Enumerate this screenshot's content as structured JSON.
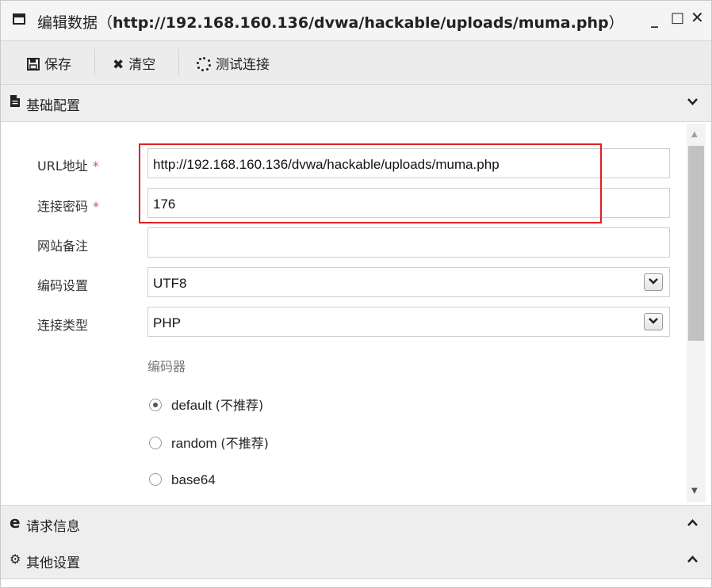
{
  "window": {
    "title_prefix": "编辑数据（",
    "title_url": "http://192.168.160.136/dvwa/hackable/uploads/muma.php",
    "title_suffix": "）",
    "minimize_glyph": "_",
    "maximize_glyph": "□",
    "close_glyph": "✕"
  },
  "toolbar": {
    "save_label": "保存",
    "clear_label": "清空",
    "test_label": "测试连接",
    "save_icon": "floppy-disk-icon",
    "clear_icon": "x-icon",
    "test_icon": "spinner-icon"
  },
  "sections": {
    "basic": {
      "label": "基础配置",
      "icon": "document-icon",
      "chevron": "⌄"
    },
    "request": {
      "label": "请求信息",
      "icon": "edge-browser-icon",
      "chevron": "⌃"
    },
    "other": {
      "label": "其他设置",
      "icon": "gears-icon",
      "chevron": "⌃"
    }
  },
  "form": {
    "url": {
      "label": "URL地址",
      "required_mark": "*",
      "value": "http://192.168.160.136/dvwa/hackable/uploads/muma.php"
    },
    "password": {
      "label": "连接密码",
      "required_mark": "*",
      "value": "176"
    },
    "note": {
      "label": "网站备注",
      "value": ""
    },
    "encoding": {
      "label": "编码设置",
      "value": "UTF8"
    },
    "type": {
      "label": "连接类型",
      "value": "PHP"
    },
    "encoder": {
      "title": "编码器",
      "options": [
        {
          "name": "default",
          "note": "(不推荐)",
          "checked": true
        },
        {
          "name": "random",
          "note": "(不推荐)",
          "checked": false
        },
        {
          "name": "base64",
          "note": "",
          "checked": false
        }
      ]
    }
  },
  "colors": {
    "highlight": "#e02020",
    "required": "#e05252"
  }
}
